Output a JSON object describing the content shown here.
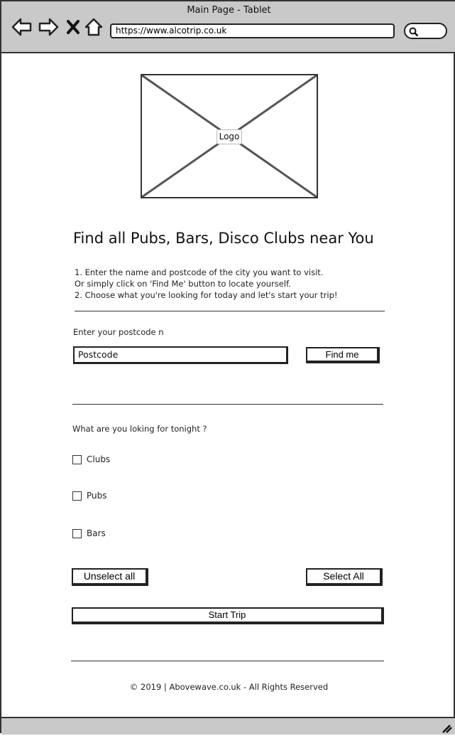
{
  "window": {
    "title": "Main Page - Tablet"
  },
  "browser": {
    "url": "https://www.alcotrip.co.uk",
    "icons": [
      "back-arrow-icon",
      "forward-arrow-icon",
      "close-x-icon",
      "home-icon",
      "search-icon",
      "resize-grip-icon"
    ]
  },
  "logo": {
    "label": "Logo"
  },
  "main": {
    "headline": "Find all Pubs, Bars, Disco Clubs near You",
    "instructions": [
      "1. Enter the name and postcode of the city you want to visit.",
      "Or simply click on 'Find Me' button to locate yourself.",
      "2. Choose what you're looking for today and let's start your trip!"
    ],
    "postcode_label": "Enter your postcode n",
    "postcode_value": "Postcode",
    "find_me_label": "Find me",
    "question": "What are you loking for tonight ?",
    "options": [
      {
        "label": "Clubs",
        "checked": false
      },
      {
        "label": "Pubs",
        "checked": false
      },
      {
        "label": "Bars",
        "checked": false
      }
    ],
    "unselect_all_label": "Unselect all",
    "select_all_label": "Select All",
    "start_trip_label": "Start Trip"
  },
  "footer": {
    "text": "© 2019 | Abovewave.co.uk - All Rights Reserved"
  }
}
